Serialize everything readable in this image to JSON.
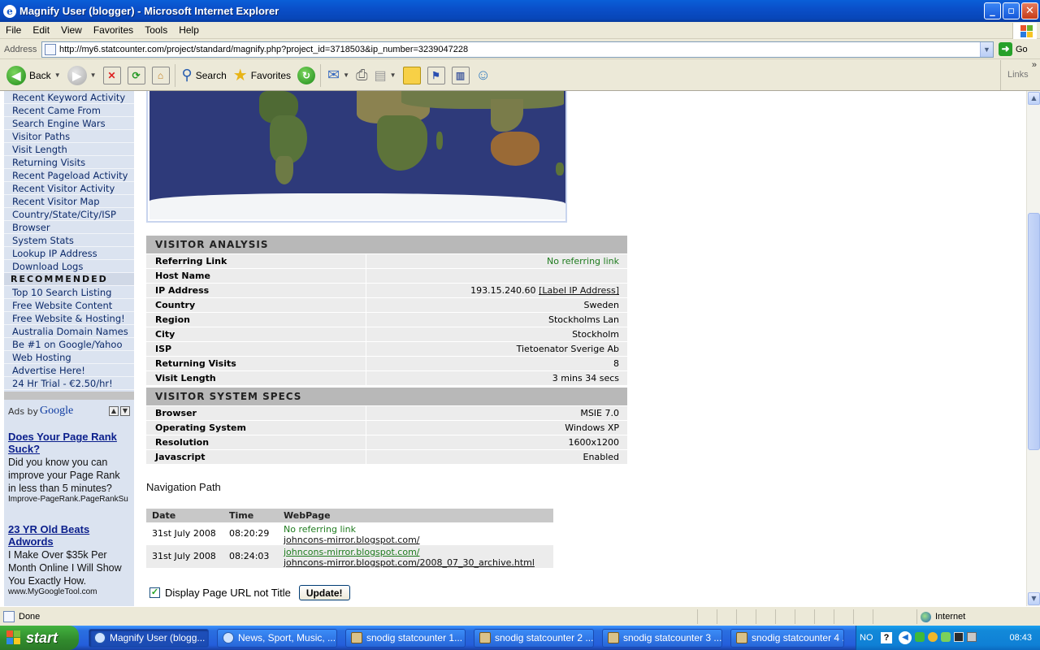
{
  "window": {
    "title": "Magnify User (blogger) - Microsoft Internet Explorer",
    "controls": [
      "_",
      "▫",
      "✕"
    ]
  },
  "menu": [
    "File",
    "Edit",
    "View",
    "Favorites",
    "Tools",
    "Help"
  ],
  "address": {
    "label": "Address",
    "url": "http://my6.statcounter.com/project/standard/magnify.php?project_id=3718503&ip_number=3239047228",
    "go_label": "Go"
  },
  "toolbar": {
    "back_label": "Back",
    "search_label": "Search",
    "favorites_label": "Favorites",
    "links_label": "Links",
    "chevron": "»"
  },
  "sidebar": {
    "links": [
      "Recent Keyword Activity",
      "Recent Came From",
      "Search Engine Wars",
      "Visitor Paths",
      "Visit Length",
      "Returning Visits",
      "Recent Pageload Activity",
      "Recent Visitor Activity",
      "Recent Visitor Map",
      "Country/State/City/ISP",
      "Browser",
      "System Stats",
      "Lookup IP Address",
      "Download Logs"
    ],
    "recommended_heading": "RECOMMENDED",
    "recommended": [
      "Top 10 Search Listing",
      "Free Website Content",
      "Free Website & Hosting!",
      "Australia Domain Names",
      "Be #1 on Google/Yahoo",
      "Web Hosting",
      "Advertise Here!",
      "24 Hr Trial - €2.50/hr!"
    ]
  },
  "ads": {
    "ads_by": "Ads by",
    "google": "Google",
    "items": [
      {
        "headline": "Does Your Page Rank Suck?",
        "body": "Did you know you can improve your Page Rank in less than 5 minutes?",
        "url": "Improve-PageRank.PageRankSu"
      },
      {
        "headline": "23 YR Old Beats Adwords",
        "body": "I Make Over $35k Per Month Online I Will Show You Exactly How.",
        "url": "www.MyGoogleTool.com"
      }
    ]
  },
  "visitor_analysis": {
    "heading": "VISITOR ANALYSIS",
    "rows": [
      {
        "key": "Referring Link",
        "value": "No referring link"
      },
      {
        "key": "Host Name",
        "value": ""
      },
      {
        "key": "IP Address",
        "value": "193.15.240.60",
        "link": "[Label IP Address]"
      },
      {
        "key": "Country",
        "value": "Sweden"
      },
      {
        "key": "Region",
        "value": "Stockholms Lan"
      },
      {
        "key": "City",
        "value": "Stockholm"
      },
      {
        "key": "ISP",
        "value": "Tietoenator Sverige Ab"
      },
      {
        "key": "Returning Visits",
        "value": "8"
      },
      {
        "key": "Visit Length",
        "value": "3 mins 34 secs"
      }
    ]
  },
  "system_specs": {
    "heading": "VISITOR SYSTEM SPECS",
    "rows": [
      {
        "key": "Browser",
        "value": "MSIE 7.0"
      },
      {
        "key": "Operating System",
        "value": "Windows XP"
      },
      {
        "key": "Resolution",
        "value": "1600x1200"
      },
      {
        "key": "Javascript",
        "value": "Enabled"
      }
    ]
  },
  "navigation": {
    "title": "Navigation Path",
    "columns": [
      "Date",
      "Time",
      "WebPage"
    ],
    "rows": [
      {
        "date": "31st July 2008",
        "time": "08:20:29",
        "line1": "No referring link",
        "line2": "johncons-mirror.blogspot.com/"
      },
      {
        "date": "31st July 2008",
        "time": "08:24:03",
        "line1": "johncons-mirror.blogspot.com/",
        "line2": "johncons-mirror.blogspot.com/2008_07_30_archive.html"
      }
    ]
  },
  "options": {
    "checkbox_label": "Display Page URL not Title",
    "checked": true,
    "update_label": "Update!"
  },
  "status": {
    "text": "Done",
    "zone": "Internet"
  },
  "taskbar": {
    "start": "start",
    "tasks": [
      {
        "label": "Magnify User (blogg...",
        "active": true,
        "icon": "ie-icon"
      },
      {
        "label": "News, Sport, Music, ...",
        "active": false,
        "icon": "ie-icon"
      },
      {
        "label": "snodig statcounter 1...",
        "active": false,
        "icon": "notes-icon"
      },
      {
        "label": "snodig statcounter 2 ...",
        "active": false,
        "icon": "notes-icon"
      },
      {
        "label": "snodig statcounter 3 ...",
        "active": false,
        "icon": "notes-icon"
      },
      {
        "label": "snodig statcounter 4 ...",
        "active": false,
        "icon": "notes-icon"
      }
    ],
    "lang": "NO",
    "clock": "08:43"
  }
}
